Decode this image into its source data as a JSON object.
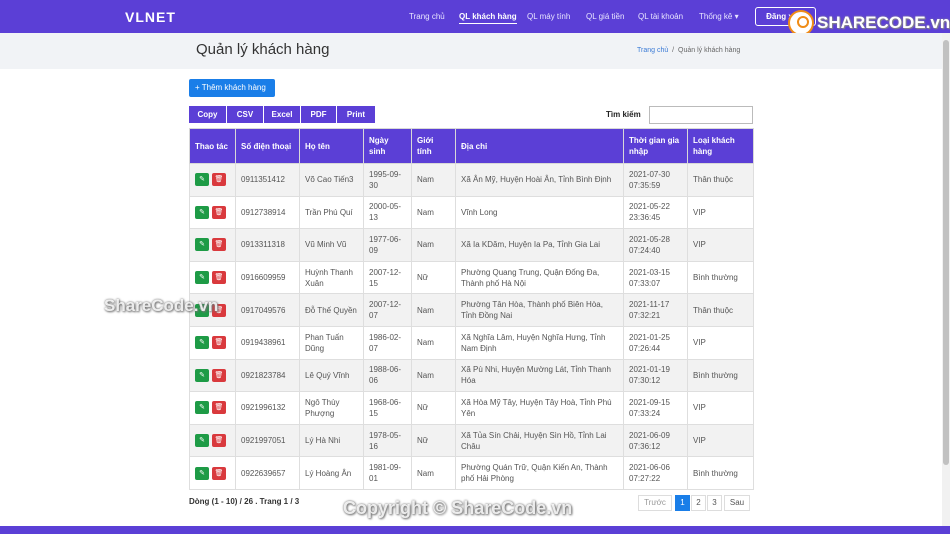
{
  "brand": "VLNET",
  "nav": {
    "items": [
      "Trang chủ",
      "QL khách hàng",
      "QL máy tính",
      "QL giá tiền",
      "QL tài khoản",
      "Thống kê"
    ],
    "dropdown_arrow": "▾",
    "logout": "Đăng xuất"
  },
  "header": {
    "title": "Quản lý khách hàng",
    "breadcrumb_home": "Trang chủ",
    "breadcrumb_sep": "/",
    "breadcrumb_current": "Quản lý khách hàng"
  },
  "toolbar": {
    "add_label": "+ Thêm khách hàng",
    "export_buttons": [
      "Copy",
      "CSV",
      "Excel",
      "PDF",
      "Print"
    ],
    "search_label": "Tìm kiếm",
    "search_value": ""
  },
  "table": {
    "headers": [
      "Thao tác",
      "Số điện thoại",
      "Họ tên",
      "Ngày sinh",
      "Giới tính",
      "Địa chỉ",
      "Thời gian gia nhập",
      "Loại khách hàng"
    ],
    "rows": [
      [
        "0911351412",
        "Võ Cao Tiến3",
        "1995-09-30",
        "Nam",
        "Xã Ân Mỹ, Huyện Hoài Ân, Tỉnh Bình Định",
        "2021-07-30 07:35:59",
        "Thân thuộc"
      ],
      [
        "0912738914",
        "Trần Phú Quí",
        "2000-05-13",
        "Nam",
        "Vĩnh Long",
        "2021-05-22 23:36:45",
        "VIP"
      ],
      [
        "0913311318",
        "Vũ Minh Vũ",
        "1977-06-09",
        "Nam",
        "Xã Ia KDăm, Huyện Ia Pa, Tỉnh Gia Lai",
        "2021-05-28 07:24:40",
        "VIP"
      ],
      [
        "0916609959",
        "Huỳnh Thanh Xuân",
        "2007-12-15",
        "Nữ",
        "Phường Quang Trung, Quận Đống Đa, Thành phố Hà Nội",
        "2021-03-15 07:33:07",
        "Bình thường"
      ],
      [
        "0917049576",
        "Đỗ Thế Quyền",
        "2007-12-07",
        "Nam",
        "Phường Tân Hòa, Thành phố Biên Hòa, Tỉnh Đồng Nai",
        "2021-11-17 07:32:21",
        "Thân thuộc"
      ],
      [
        "0919438961",
        "Phan Tuấn Dũng",
        "1986-02-07",
        "Nam",
        "Xã Nghĩa Lâm, Huyện Nghĩa Hưng, Tỉnh Nam Định",
        "2021-01-25 07:26:44",
        "VIP"
      ],
      [
        "0921823784",
        "Lê Quý Vĩnh",
        "1988-06-06",
        "Nam",
        "Xã Pù Nhi, Huyện Mường Lát, Tỉnh Thanh Hóa",
        "2021-01-19 07:30:12",
        "Bình thường"
      ],
      [
        "0921996132",
        "Ngô Thùy Phượng",
        "1968-06-15",
        "Nữ",
        "Xã Hòa Mỹ Tây, Huyện Tây Hoà, Tỉnh Phú Yên",
        "2021-09-15 07:33:24",
        "VIP"
      ],
      [
        "0921997051",
        "Lý Hà Nhi",
        "1978-05-16",
        "Nữ",
        "Xã Tủa Sín Chải, Huyện Sìn Hồ, Tỉnh Lai Châu",
        "2021-06-09 07:36:12",
        "VIP"
      ],
      [
        "0922639657",
        "Lý Hoàng Ân",
        "1981-09-01",
        "Nam",
        "Phường Quán Trữ, Quận Kiến An, Thành phố Hải Phòng",
        "2021-06-06 07:27:22",
        "Bình thường"
      ]
    ],
    "edit_icon": "✎",
    "delete_icon": "🗑"
  },
  "footer": {
    "info": "Dòng (1 - 10) / 26 . Trang 1 / 3",
    "prev": "Trước",
    "pages": [
      "1",
      "2",
      "3"
    ],
    "next": "Sau"
  },
  "watermarks": {
    "logo": "SHARECODE.vn",
    "side": "ShareCode.vn",
    "bottom": "Copyright © ShareCode.vn"
  },
  "colors": {
    "primary": "#5b3fd6",
    "add_button": "#1a7ee8",
    "edit": "#1e9b46",
    "delete": "#d9393d"
  }
}
